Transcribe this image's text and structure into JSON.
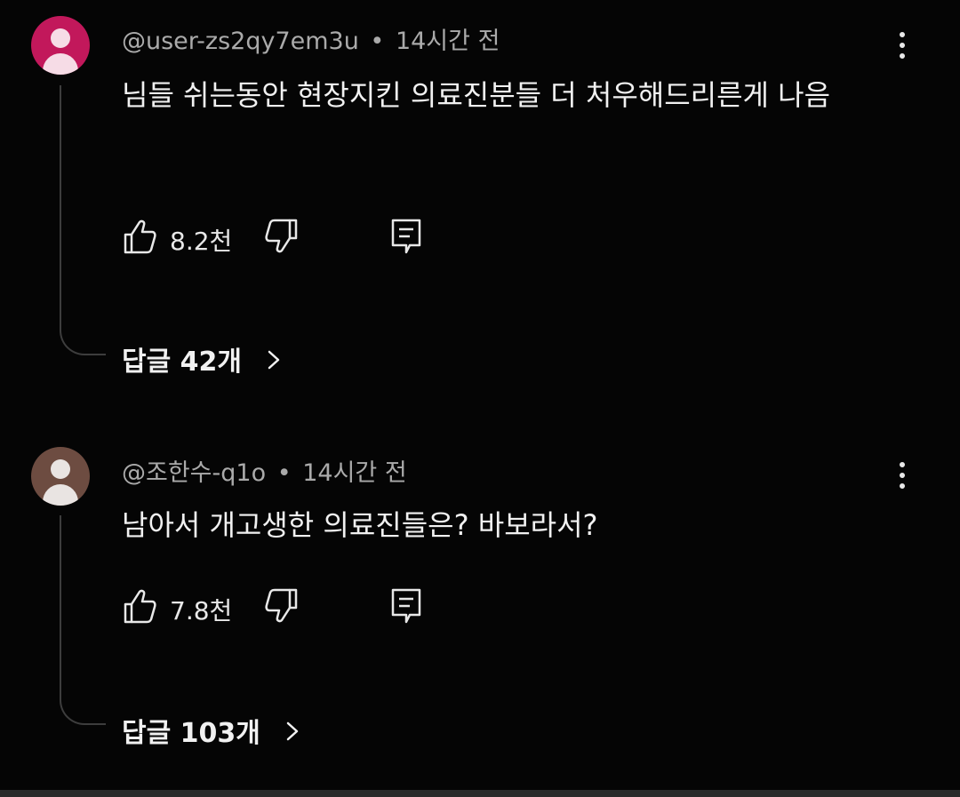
{
  "colors": {
    "background": "#050505",
    "avatar1": "#c2185b",
    "avatar2": "#6d4c41",
    "meta_text": "#aaaaaa",
    "thread_line": "#3d3d3d"
  },
  "comments": [
    {
      "handle": "@user-zs2qy7em3u",
      "separator": "•",
      "time": "14시간 전",
      "text": "님들 쉬는동안 현장지킨 의료진분들 더 처우해드리른게 나음",
      "likes": "8.2천",
      "replies_label": "답글 42개",
      "icons": [
        "avatar-icon",
        "kebab-menu-icon",
        "thumbs-up-icon",
        "thumbs-down-icon",
        "reply-icon",
        "chevron-right-icon"
      ]
    },
    {
      "handle": "@조한수-q1o",
      "separator": "•",
      "time": "14시간 전",
      "text": "남아서 개고생한 의료진들은? 바보라서?",
      "likes": "7.8천",
      "replies_label": "답글 103개",
      "icons": [
        "avatar-icon",
        "kebab-menu-icon",
        "thumbs-up-icon",
        "thumbs-down-icon",
        "reply-icon",
        "chevron-right-icon"
      ]
    }
  ]
}
